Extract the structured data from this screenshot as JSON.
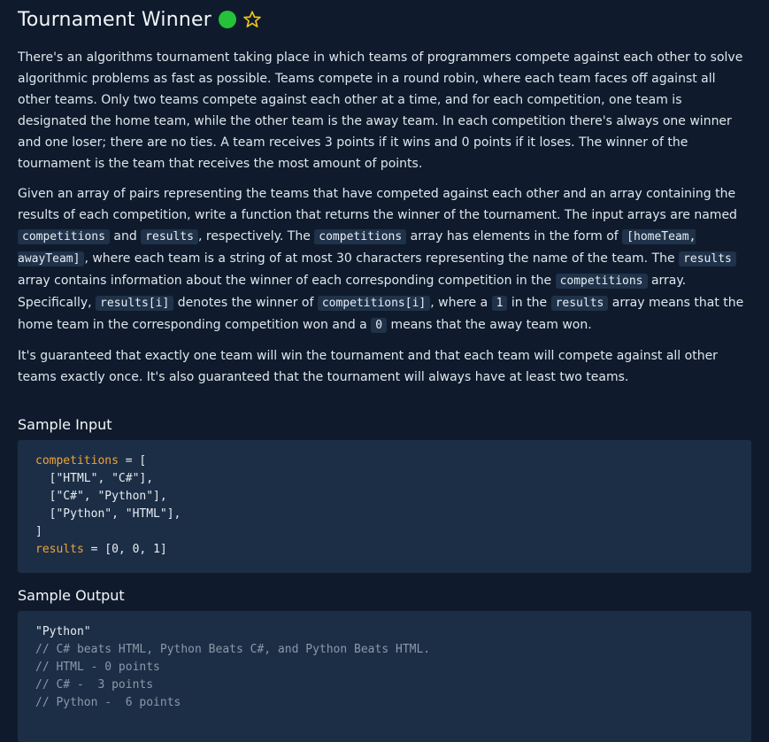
{
  "title": "Tournament Winner",
  "status_color": "#25c13a",
  "star_icon": "star-outline-icon",
  "paragraph1": "There's an algorithms tournament taking place in which teams of programmers compete against each other to solve algorithmic problems as fast as possible. Teams compete in a round robin, where each team faces off against all other teams. Only two teams compete against each other at a time, and for each competition, one team is designated the home team, while the other team is the away team. In each competition there's always one winner and one loser; there are no ties. A team receives 3 points if it wins and 0 points if it loses. The winner of the tournament is the team that receives the most amount of points.",
  "p2": {
    "t1": "Given an array of pairs representing the teams that have competed against each other and an array containing the results of each competition, write a function that returns the winner of the tournament. The input arrays are named ",
    "c1": "competitions",
    "t2": " and ",
    "c2": "results",
    "t3": ", respectively. The ",
    "c3": "competitions",
    "t4": " array has elements in the form of ",
    "c4": "[homeTeam, awayTeam]",
    "t5": ", where each team is a string of at most 30 characters representing the name of the team. The ",
    "c5": "results",
    "t6": " array contains information about the winner of each corresponding competition in the ",
    "c6": "competitions",
    "t7": " array. Specifically, ",
    "c7": "results[i]",
    "t8": " denotes the winner of ",
    "c8": "competitions[i]",
    "t9": ", where a ",
    "c9": "1",
    "t10": " in the ",
    "c10": "results",
    "t11": " array means that the home team in the corresponding competition won and a ",
    "c11": "0",
    "t12": " means that the away team won."
  },
  "paragraph3": "It's guaranteed that exactly one team will win the tournament and that each team will compete against all other teams exactly once. It's also guaranteed that the tournament will always have at least two teams.",
  "sample_input": {
    "heading": "Sample Input",
    "line1_var": "competitions",
    "line1_rest": " = [",
    "line2": "  [\"HTML\", \"C#\"],",
    "line3": "  [\"C#\", \"Python\"],",
    "line4": "  [\"Python\", \"HTML\"],",
    "line5": "]",
    "line6_var": "results",
    "line6_rest": " = [0, 0, 1]"
  },
  "sample_output": {
    "heading": "Sample Output",
    "line1": "\"Python\"",
    "line2": "// C# beats HTML, Python Beats C#, and Python Beats HTML.",
    "line3": "// HTML - 0 points",
    "line4": "// C# -  3 points",
    "line5": "// Python -  6 points"
  }
}
